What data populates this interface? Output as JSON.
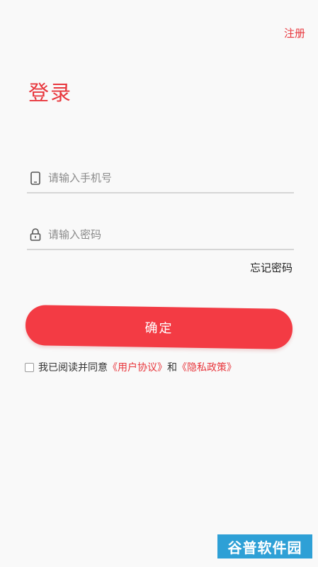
{
  "header": {
    "register_label": "注册",
    "title": "登录"
  },
  "form": {
    "phone_placeholder": "请输入手机号",
    "phone_value": "",
    "password_placeholder": "请输入密码",
    "password_value": "",
    "forgot_label": "忘记密码",
    "confirm_label": "确定"
  },
  "agreement": {
    "prefix": "我已阅读并同意",
    "user_agreement": "《用户协议》",
    "conjunction": "和",
    "privacy_policy": "《隐私政策》",
    "checked": false
  },
  "watermark": {
    "text": "谷普软件园"
  },
  "colors": {
    "accent": "#e8363c",
    "button": "#f33b44",
    "background": "#f9f9f9",
    "divider": "#d6d6d6"
  },
  "icons": {
    "phone": "phone-icon",
    "lock": "lock-icon"
  }
}
